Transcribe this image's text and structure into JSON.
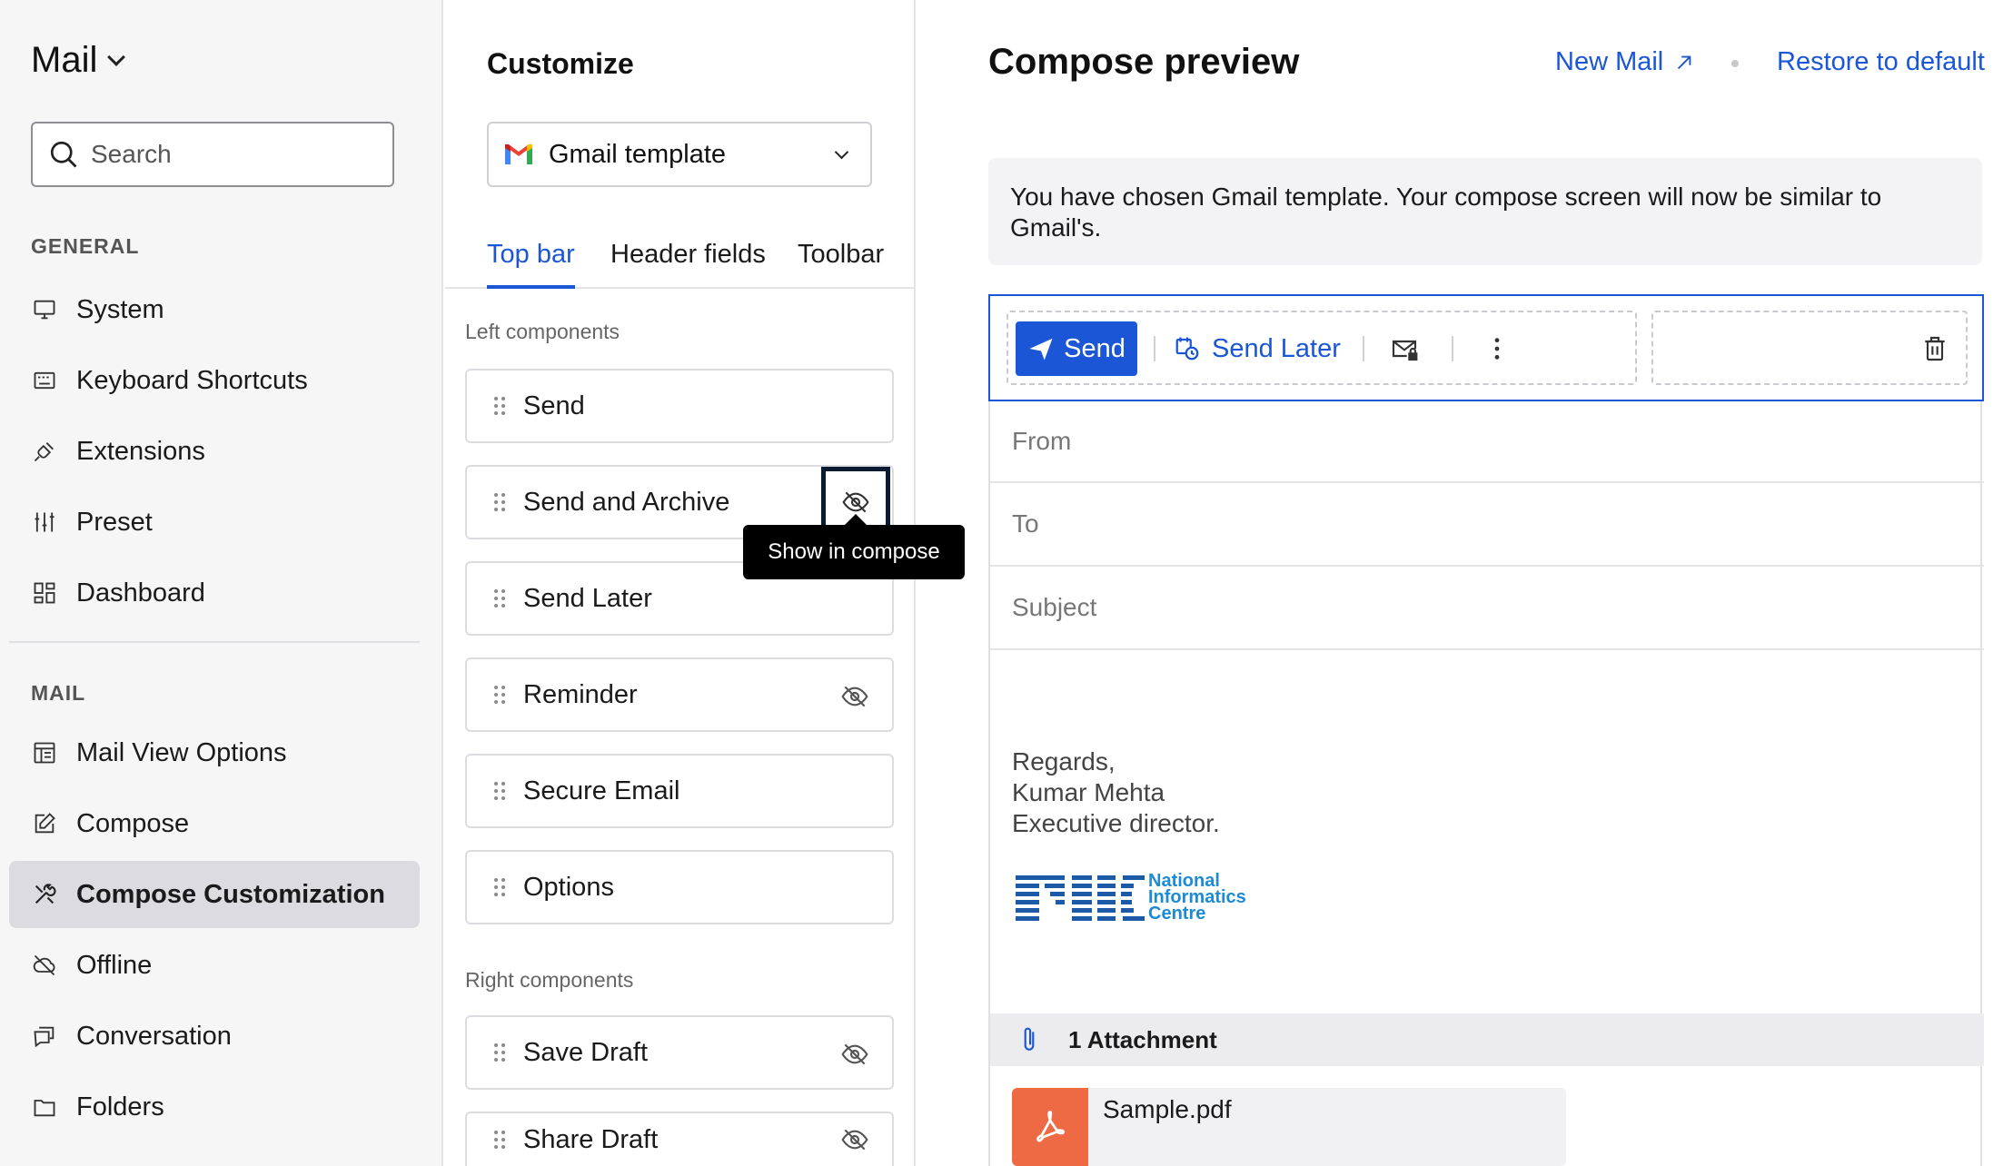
{
  "sidebar": {
    "app_title": "Mail",
    "search_placeholder": "Search",
    "sections": {
      "general": "GENERAL",
      "mail": "MAIL"
    },
    "items": [
      {
        "label": "System",
        "icon": "monitor-icon"
      },
      {
        "label": "Keyboard Shortcuts",
        "icon": "keyboard-icon"
      },
      {
        "label": "Extensions",
        "icon": "plug-icon"
      },
      {
        "label": "Preset",
        "icon": "sliders-icon"
      },
      {
        "label": "Dashboard",
        "icon": "dashboard-icon"
      },
      {
        "label": "Mail View Options",
        "icon": "mail-view-icon"
      },
      {
        "label": "Compose",
        "icon": "compose-icon"
      },
      {
        "label": "Compose Customization",
        "icon": "tools-icon",
        "active": true
      },
      {
        "label": "Offline",
        "icon": "cloud-off-icon"
      },
      {
        "label": "Conversation",
        "icon": "conversation-icon"
      },
      {
        "label": "Folders",
        "icon": "folder-icon"
      }
    ]
  },
  "customize": {
    "title": "Customize",
    "template": "Gmail template",
    "tabs": [
      {
        "label": "Top bar",
        "active": true
      },
      {
        "label": "Header fields"
      },
      {
        "label": "Toolbar"
      }
    ],
    "left_label": "Left components",
    "left_components": [
      "Send",
      "Send and Archive",
      "Send Later",
      "Reminder",
      "Secure Email",
      "Options"
    ],
    "right_label": "Right components",
    "right_components": [
      "Save Draft",
      "Share Draft"
    ],
    "tooltip": "Show in compose"
  },
  "preview": {
    "title": "Compose preview",
    "new_mail": "New Mail",
    "restore": "Restore to default",
    "notice": "You have chosen Gmail template. Your compose screen will now be similar to Gmail's.",
    "send": "Send",
    "send_later": "Send Later",
    "fields": {
      "from": "From",
      "to": "To",
      "subject": "Subject"
    },
    "signature": {
      "line1": "Regards,",
      "line2": "Kumar Mehta",
      "line3": "Executive director."
    },
    "logo_text": {
      "l1": "National",
      "l2": "Informatics",
      "l3": "Centre"
    },
    "attachment_count": "1 Attachment",
    "file_name": "Sample.pdf",
    "accent_color": "#1a56d6"
  }
}
